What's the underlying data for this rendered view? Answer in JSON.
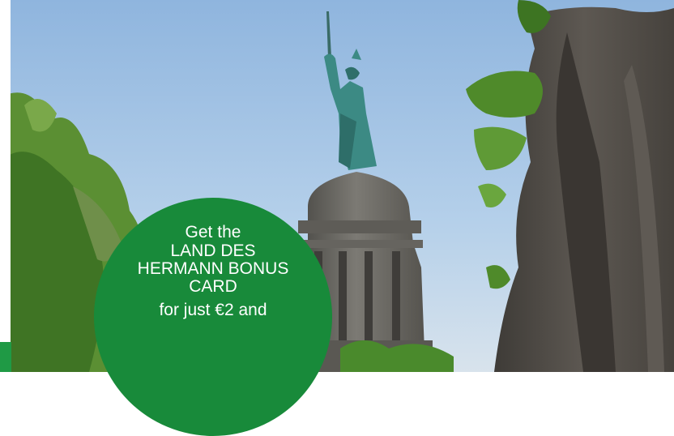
{
  "image": {
    "description_icon": "hermann-monument-photo",
    "sky_color": "#a9c8e6",
    "foliage_color": "#4f8a2a",
    "statue_color": "#3c8a84",
    "stone_color": "#6b6a66",
    "rock_color": "#4e4a45"
  },
  "badge": {
    "background": "#188a3a",
    "line1": "Get the",
    "line2": "LAND DES",
    "line3": "HERMANN BONUS",
    "line4": "CARD",
    "line5": "for just €2 and"
  },
  "accent": {
    "tab_color": "#1f9a45"
  }
}
